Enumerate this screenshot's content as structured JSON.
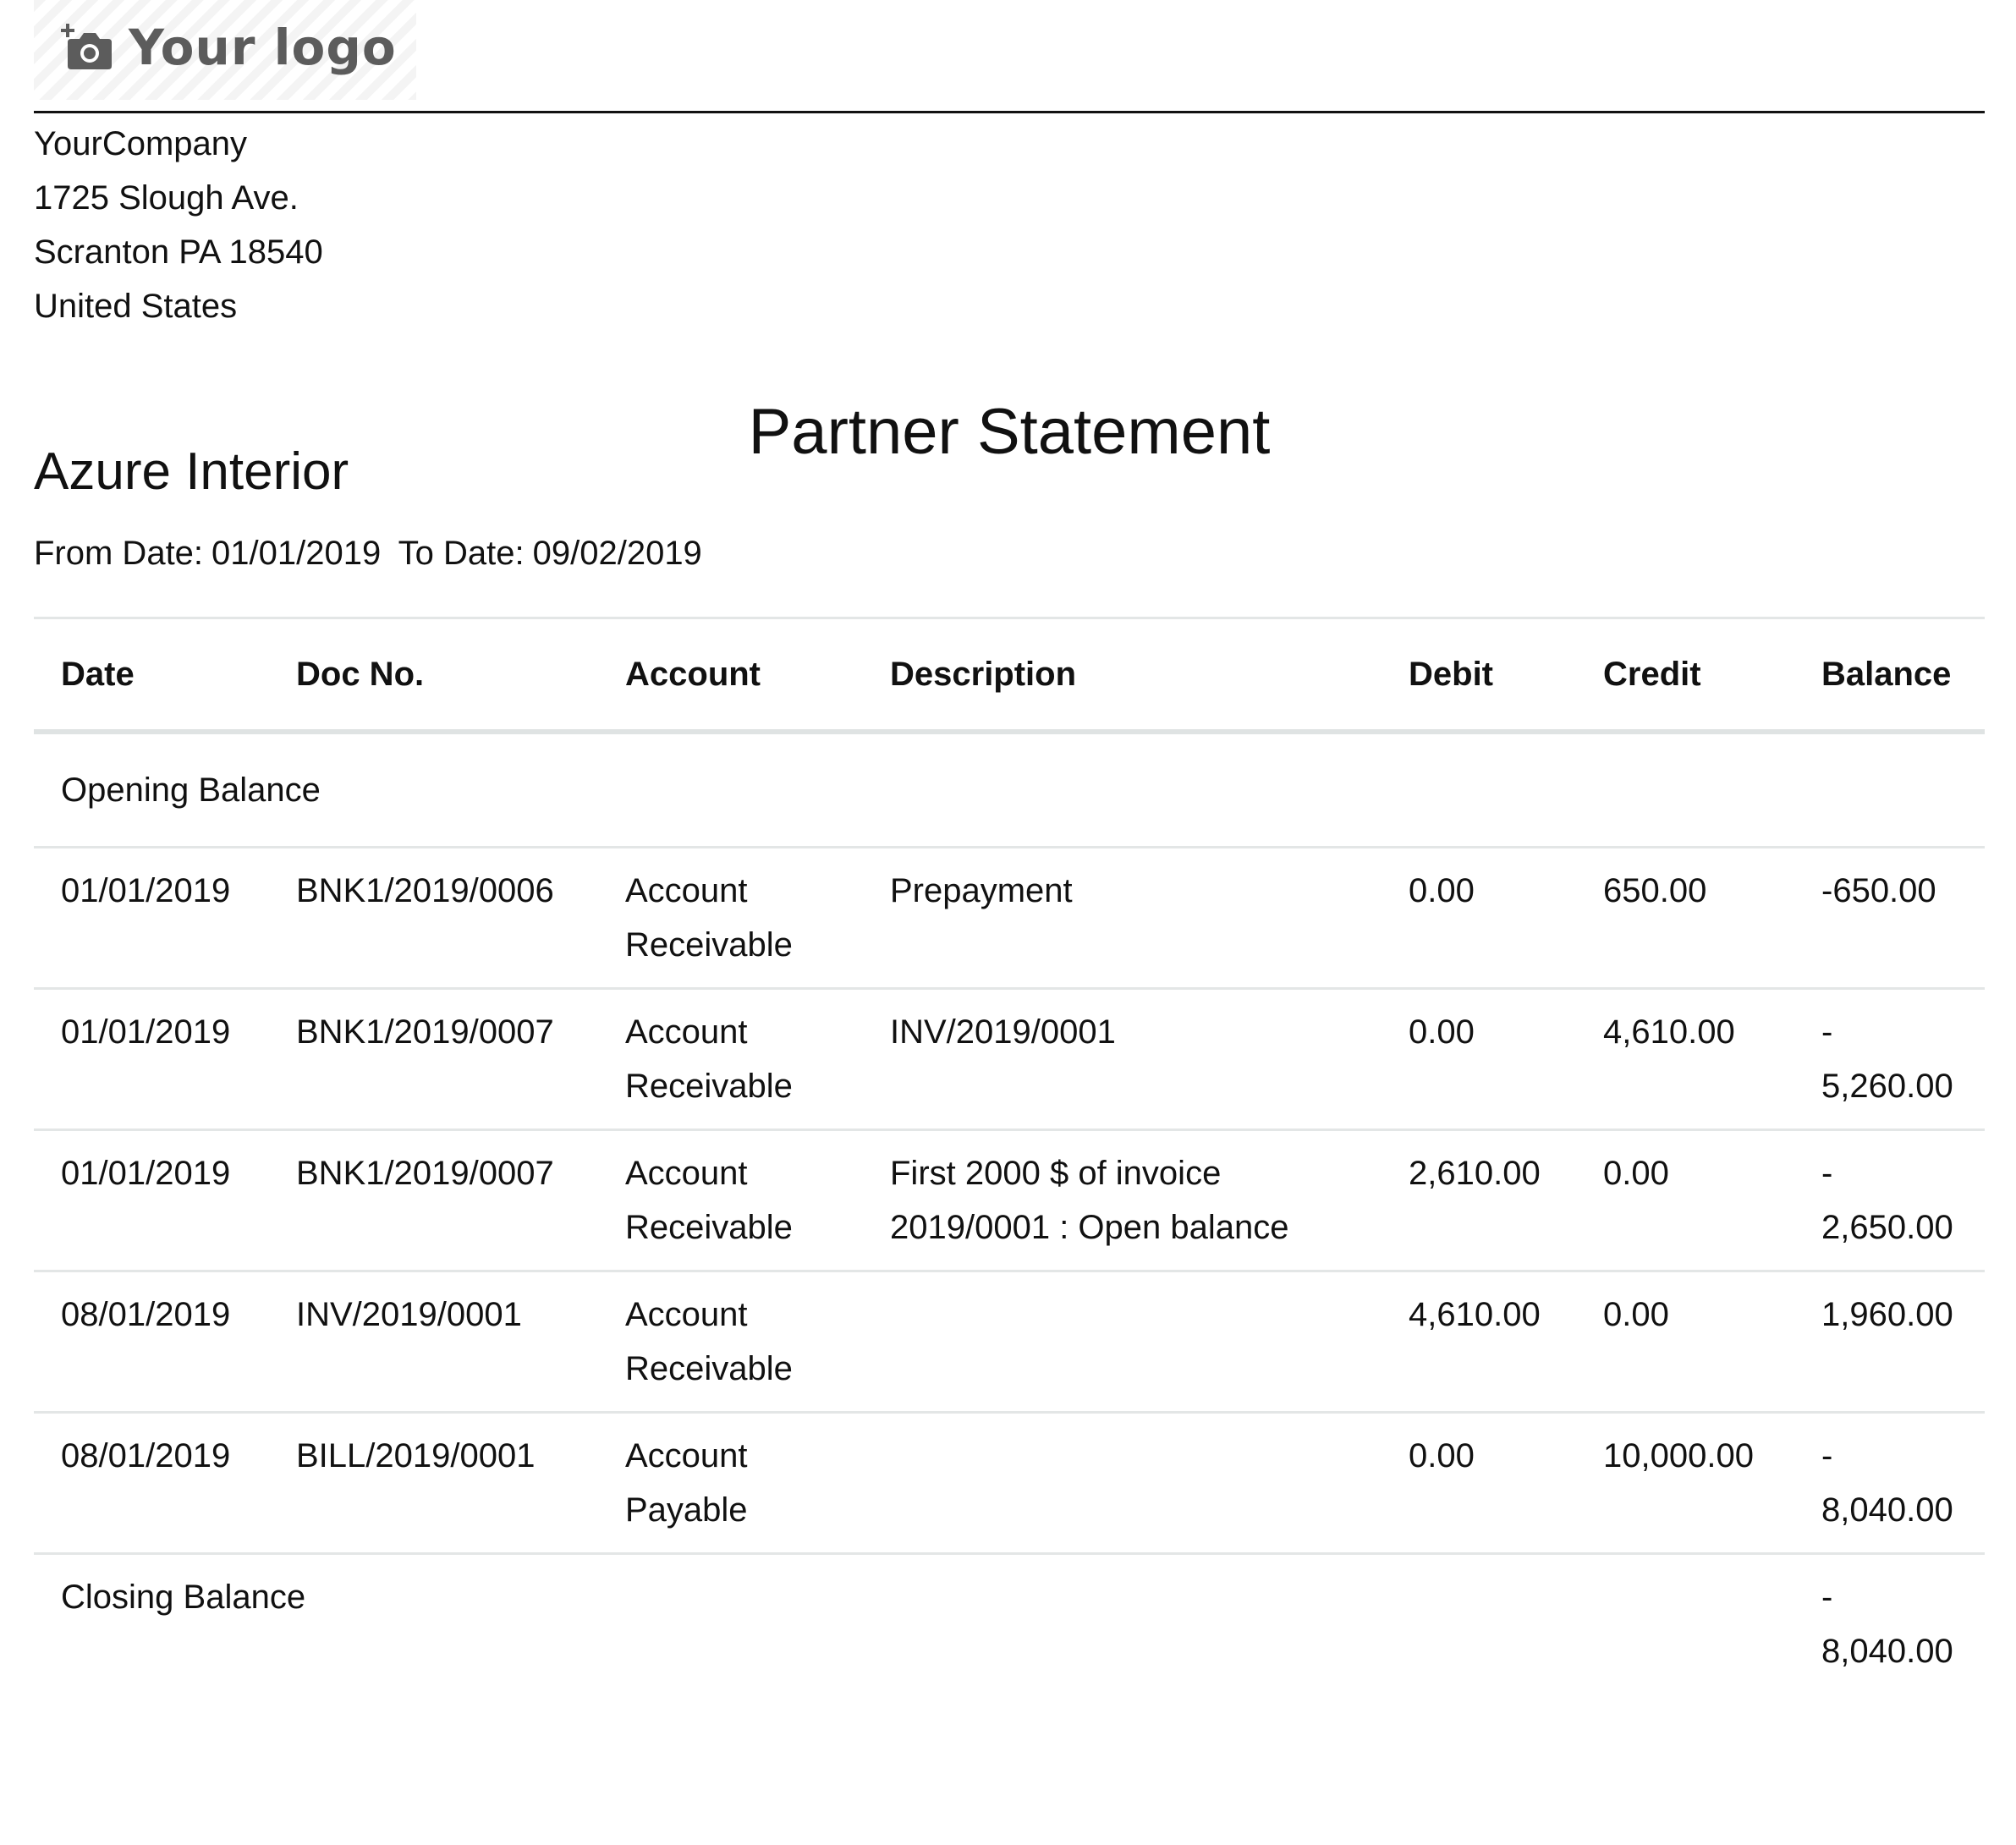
{
  "logo": {
    "icon": "camera-plus-icon",
    "text": "Your logo"
  },
  "company": {
    "name": "YourCompany",
    "street": "1725 Slough Ave.",
    "city_line": "Scranton PA 18540",
    "country": "United States"
  },
  "document": {
    "title": "Partner Statement",
    "partner": "Azure Interior",
    "from_label": "From Date:",
    "from_value": "01/01/2019",
    "to_label": "To Date:",
    "to_value": "09/02/2019"
  },
  "table": {
    "headers": {
      "date": "Date",
      "doc_no": "Doc No.",
      "account": "Account",
      "description": "Description",
      "debit": "Debit",
      "credit": "Credit",
      "balance": "Balance"
    },
    "opening_label": "Opening Balance",
    "rows": [
      {
        "date": "01/01/2019",
        "doc_no": "BNK1/2019/0006",
        "account_line1": "Account",
        "account_line2": "Receivable",
        "description_line1": "Prepayment",
        "description_line2": "",
        "debit": "0.00",
        "credit": "650.00",
        "balance_line1": "-650.00",
        "balance_line2": ""
      },
      {
        "date": "01/01/2019",
        "doc_no": "BNK1/2019/0007",
        "account_line1": "Account",
        "account_line2": "Receivable",
        "description_line1": "INV/2019/0001",
        "description_line2": "",
        "debit": "0.00",
        "credit": "4,610.00",
        "balance_line1": "-",
        "balance_line2": "5,260.00"
      },
      {
        "date": "01/01/2019",
        "doc_no": "BNK1/2019/0007",
        "account_line1": "Account",
        "account_line2": "Receivable",
        "description_line1": "First 2000 $ of invoice",
        "description_line2": "2019/0001 : Open balance",
        "debit": "2,610.00",
        "credit": "0.00",
        "balance_line1": "-",
        "balance_line2": "2,650.00"
      },
      {
        "date": "08/01/2019",
        "doc_no": "INV/2019/0001",
        "account_line1": "Account",
        "account_line2": "Receivable",
        "description_line1": "",
        "description_line2": "",
        "debit": "4,610.00",
        "credit": "0.00",
        "balance_line1": "1,960.00",
        "balance_line2": ""
      },
      {
        "date": "08/01/2019",
        "doc_no": "BILL/2019/0001",
        "account_line1": "Account",
        "account_line2": "Payable",
        "description_line1": "",
        "description_line2": "",
        "debit": "0.00",
        "credit": "10,000.00",
        "balance_line1": "-",
        "balance_line2": "8,040.00"
      }
    ],
    "closing": {
      "label": "Closing Balance",
      "balance_line1": "-",
      "balance_line2": "8,040.00"
    }
  }
}
